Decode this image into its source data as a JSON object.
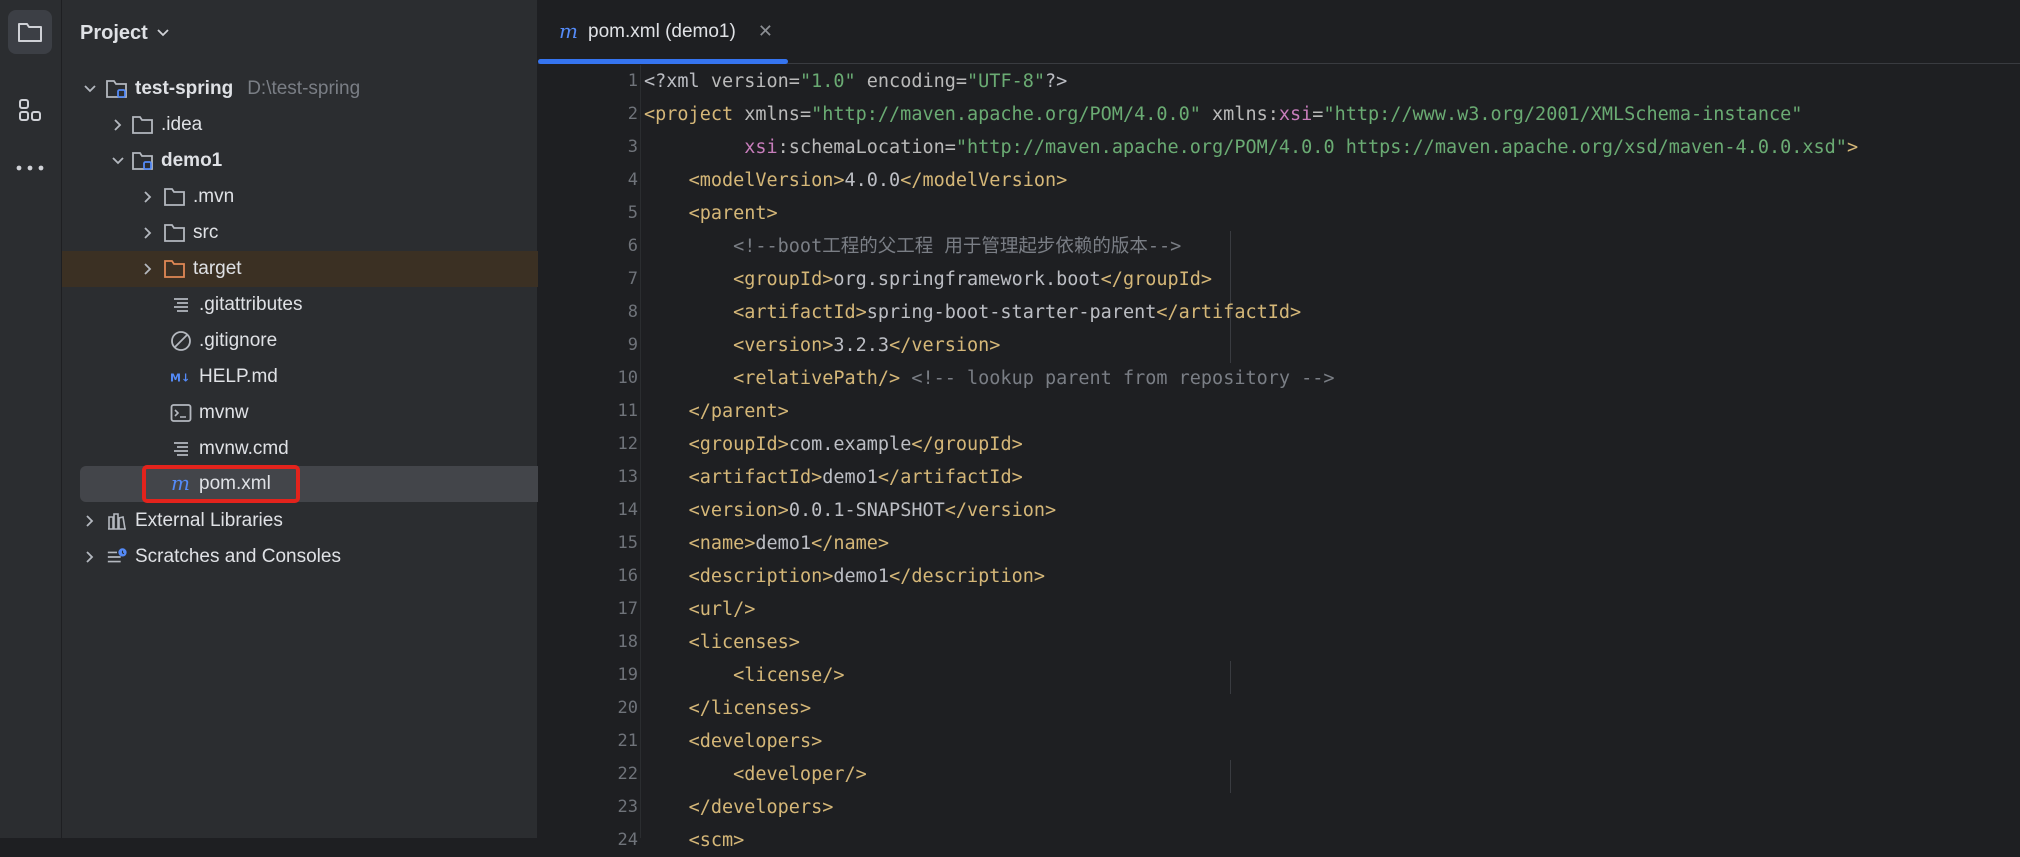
{
  "project_panel": {
    "title": "Project",
    "tree": [
      {
        "label": "test-spring",
        "hint": "D:\\test-spring"
      },
      {
        "label": ".idea"
      },
      {
        "label": "demo1"
      },
      {
        "label": ".mvn"
      },
      {
        "label": "src"
      },
      {
        "label": "target"
      },
      {
        "label": ".gitattributes"
      },
      {
        "label": ".gitignore"
      },
      {
        "label": "HELP.md"
      },
      {
        "label": "mvnw"
      },
      {
        "label": "mvnw.cmd"
      },
      {
        "label": "pom.xml"
      },
      {
        "label": "External Libraries"
      },
      {
        "label": "Scratches and Consoles"
      }
    ]
  },
  "editor": {
    "tab_label": "pom.xml (demo1)",
    "line_numbers": [
      "1",
      "2",
      "3",
      "4",
      "5",
      "6",
      "7",
      "8",
      "9",
      "10",
      "11",
      "12",
      "13",
      "14",
      "15",
      "16",
      "17",
      "18",
      "19",
      "20",
      "21",
      "22",
      "23",
      "24"
    ],
    "lines": [
      [
        [
          "x",
          "<?xml "
        ],
        [
          "a",
          "version="
        ],
        [
          "v",
          "\"1.0\""
        ],
        [
          "a",
          " encoding="
        ],
        [
          "v",
          "\"UTF-8\""
        ],
        [
          "x",
          "?>"
        ]
      ],
      [
        [
          "t",
          "<project "
        ],
        [
          "a",
          "xmlns="
        ],
        [
          "v",
          "\"http://maven.apache.org/POM/4.0.0\""
        ],
        [
          "a",
          " xmlns:"
        ],
        [
          "ns",
          "xsi"
        ],
        [
          "a",
          "="
        ],
        [
          "v",
          "\"http://www.w3.org/2001/XMLSchema-instance\""
        ]
      ],
      [
        [
          "a",
          "         "
        ],
        [
          "ns",
          "xsi"
        ],
        [
          "a",
          ":schemaLocation="
        ],
        [
          "v",
          "\"http://maven.apache.org/POM/4.0.0 https://maven.apache.org/xsd/maven-4.0.0.xsd\""
        ],
        [
          "t",
          ">"
        ]
      ],
      [
        [
          "x",
          "    "
        ],
        [
          "t",
          "<modelVersion>"
        ],
        [
          "x",
          "4.0.0"
        ],
        [
          "t",
          "</modelVersion>"
        ]
      ],
      [
        [
          "x",
          "    "
        ],
        [
          "t",
          "<parent>"
        ]
      ],
      [
        [
          "x",
          "        "
        ],
        [
          "c",
          "<!--boot工程的父工程 用于管理起步依赖的版本-->"
        ]
      ],
      [
        [
          "x",
          "        "
        ],
        [
          "t",
          "<groupId>"
        ],
        [
          "x",
          "org.springframework.boot"
        ],
        [
          "t",
          "</groupId>"
        ]
      ],
      [
        [
          "x",
          "        "
        ],
        [
          "t",
          "<artifactId>"
        ],
        [
          "x",
          "spring-boot-starter-parent"
        ],
        [
          "t",
          "</artifactId>"
        ]
      ],
      [
        [
          "x",
          "        "
        ],
        [
          "t",
          "<version>"
        ],
        [
          "x",
          "3.2.3"
        ],
        [
          "t",
          "</version>"
        ]
      ],
      [
        [
          "x",
          "        "
        ],
        [
          "t",
          "<relativePath/>"
        ],
        [
          "c",
          " <!-- lookup parent from repository -->"
        ]
      ],
      [
        [
          "x",
          "    "
        ],
        [
          "t",
          "</parent>"
        ]
      ],
      [
        [
          "x",
          "    "
        ],
        [
          "t",
          "<groupId>"
        ],
        [
          "x",
          "com.example"
        ],
        [
          "t",
          "</groupId>"
        ]
      ],
      [
        [
          "x",
          "    "
        ],
        [
          "t",
          "<artifactId>"
        ],
        [
          "x",
          "demo1"
        ],
        [
          "t",
          "</artifactId>"
        ]
      ],
      [
        [
          "x",
          "    "
        ],
        [
          "t",
          "<version>"
        ],
        [
          "x",
          "0.0.1-SNAPSHOT"
        ],
        [
          "t",
          "</version>"
        ]
      ],
      [
        [
          "x",
          "    "
        ],
        [
          "t",
          "<name>"
        ],
        [
          "x",
          "demo1"
        ],
        [
          "t",
          "</name>"
        ]
      ],
      [
        [
          "x",
          "    "
        ],
        [
          "t",
          "<description>"
        ],
        [
          "x",
          "demo1"
        ],
        [
          "t",
          "</description>"
        ]
      ],
      [
        [
          "x",
          "    "
        ],
        [
          "t",
          "<url/>"
        ]
      ],
      [
        [
          "x",
          "    "
        ],
        [
          "t",
          "<licenses>"
        ]
      ],
      [
        [
          "x",
          "        "
        ],
        [
          "t",
          "<license/>"
        ]
      ],
      [
        [
          "x",
          "    "
        ],
        [
          "t",
          "</licenses>"
        ]
      ],
      [
        [
          "x",
          "    "
        ],
        [
          "t",
          "<developers>"
        ]
      ],
      [
        [
          "x",
          "        "
        ],
        [
          "t",
          "<developer/>"
        ]
      ],
      [
        [
          "x",
          "    "
        ],
        [
          "t",
          "</developers>"
        ]
      ],
      [
        [
          "x",
          "    "
        ],
        [
          "t",
          "<scm>"
        ]
      ]
    ]
  },
  "colors": {
    "accent": "#3574f0",
    "tag": "#d5b778",
    "string": "#6aab73",
    "comment": "#7a7e85",
    "highlight_box": "#e3231c"
  }
}
